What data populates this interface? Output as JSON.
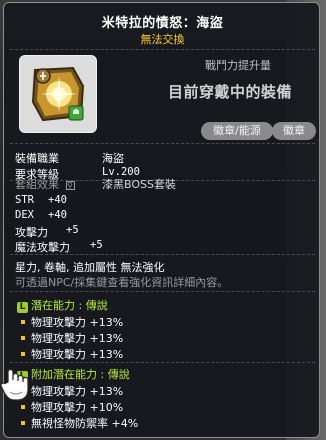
{
  "item": {
    "name": "米特拉的憤怒：海盜",
    "trade_status": "無法交換",
    "icon_name": "mitra-rage-emblem-icon",
    "stat_increase_label": "戰鬥力提升量",
    "equip_status": "目前穿戴中的裝備"
  },
  "tags": [
    "徽章/能源",
    "徽章"
  ],
  "requirements": {
    "job_label": "裝備職業",
    "job_value": "海盜",
    "level_label": "要求等級",
    "level_value": "Lv.200"
  },
  "set": {
    "label": "套組效果",
    "value": "漆黑BOSS套裝"
  },
  "stats": [
    {
      "name": "STR",
      "value": "+40"
    },
    {
      "name": "DEX",
      "value": "+40"
    },
    {
      "name": "攻擊力",
      "value": "+5"
    },
    {
      "name": "魔法攻擊力",
      "value": "+5"
    }
  ],
  "notes": {
    "enhance": "星力, 卷軸, 追加屬性 無法強化",
    "npc": "可透過NPC/採集鍵查看強化資訊詳細內容。"
  },
  "potential": {
    "badge": "L",
    "title": "潛在能力 : 傳說",
    "lines": [
      "物理攻擊力 +13%",
      "物理攻擊力 +13%",
      "物理攻擊力 +13%"
    ]
  },
  "additional_potential": {
    "badge": "L",
    "title": "附加潛在能力 : 傳說",
    "lines": [
      "物理攻擊力 +13%",
      "物理攻擊力 +10%",
      "無視怪物防禦率 +4%"
    ]
  },
  "colors": {
    "title": "#ffffff",
    "trade": "#ffcc33",
    "potential": "#b8ef3a",
    "bullet": "#f2c230",
    "tag_bg": "#8a8a8a"
  }
}
